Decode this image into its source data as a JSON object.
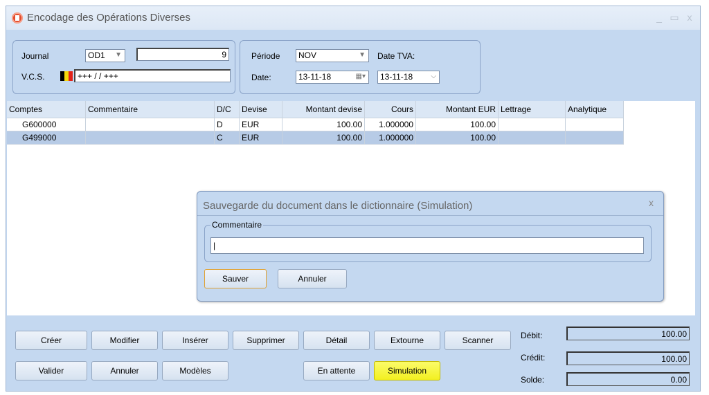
{
  "window": {
    "title": "Encodage des Opérations Diverses",
    "minimize": "_",
    "maximize": "▭",
    "close": "x"
  },
  "header": {
    "journal_label": "Journal",
    "journal_code": "OD1",
    "journal_number": "9",
    "vcs_label": "V.C.S.",
    "vcs_value": "+++  /   /    +++",
    "periode_label": "Période",
    "periode_value": "NOV",
    "date_tva_label": "Date TVA:",
    "date_label": "Date:",
    "date_value": "13-11-18",
    "date_tva_value": "13-11-18",
    "flag_colors": [
      "#000000",
      "#f5d90a",
      "#e32219"
    ]
  },
  "table": {
    "columns": [
      "Comptes",
      "Commentaire",
      "D/C",
      "Devise",
      "Montant devise",
      "Cours",
      "Montant EUR",
      "Lettrage",
      "Analytique"
    ],
    "rows": [
      [
        "G600000",
        "",
        "D",
        "EUR",
        "100.00",
        "1.000000",
        "100.00",
        "",
        ""
      ],
      [
        "G499000",
        "",
        "C",
        "EUR",
        "100.00",
        "1.000000",
        "100.00",
        "",
        ""
      ]
    ]
  },
  "dialog": {
    "title": "Sauvegarde du document dans le dictionnaire (Simulation)",
    "close": "x",
    "group_label": "Commentaire",
    "input_value": "",
    "save_label": "Sauver",
    "cancel_label": "Annuler"
  },
  "buttons": {
    "creer": "Créer",
    "modifier": "Modifier",
    "inserer": "Insérer",
    "supprimer": "Supprimer",
    "detail": "Détail",
    "extourne": "Extourne",
    "scanner": "Scanner",
    "valider": "Valider",
    "annuler": "Annuler",
    "modeles": "Modèles",
    "en_attente": "En attente",
    "simulation": "Simulation"
  },
  "totals": {
    "debit_label": "Débit:",
    "debit_value": "100.00",
    "credit_label": "Crédit:",
    "credit_value": "100.00",
    "solde_label": "Solde:",
    "solde_value": "0.00"
  }
}
